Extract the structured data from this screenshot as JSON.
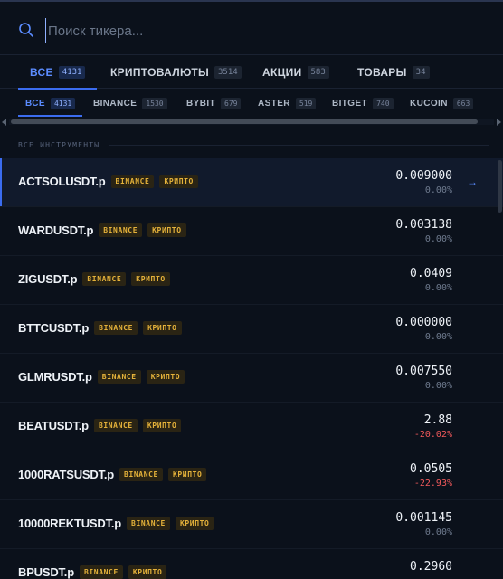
{
  "search": {
    "placeholder": "Поиск тикера..."
  },
  "tabs_primary": [
    {
      "label": "ВСЕ",
      "count": "4131",
      "active": true
    },
    {
      "label": "КРИПТОВАЛЮТЫ",
      "count": "3514"
    },
    {
      "label": "АКЦИИ",
      "count": "583"
    },
    {
      "label": "ТОВАРЫ",
      "count": "34"
    }
  ],
  "tabs_exchange": [
    {
      "label": "ВСЕ",
      "count": "4131",
      "active": true
    },
    {
      "label": "BINANCE",
      "count": "1530"
    },
    {
      "label": "BYBIT",
      "count": "679"
    },
    {
      "label": "ASTER",
      "count": "519"
    },
    {
      "label": "BITGET",
      "count": "740"
    },
    {
      "label": "KUCOIN",
      "count": "663"
    }
  ],
  "section_label": "ВСЕ ИНСТРУМЕНТЫ",
  "instruments": [
    {
      "symbol": "ACTSOLUSDT.p",
      "exchange": "BINANCE",
      "type": "КРИПТО",
      "price": "0.009000",
      "change": "0.00%",
      "direction": "flat",
      "selected": true
    },
    {
      "symbol": "WARDUSDT.p",
      "exchange": "BINANCE",
      "type": "КРИПТО",
      "price": "0.003138",
      "change": "0.00%",
      "direction": "flat"
    },
    {
      "symbol": "ZIGUSDT.p",
      "exchange": "BINANCE",
      "type": "КРИПТО",
      "price": "0.0409",
      "change": "0.00%",
      "direction": "flat"
    },
    {
      "symbol": "BTTCUSDT.p",
      "exchange": "BINANCE",
      "type": "КРИПТО",
      "price": "0.000000",
      "change": "0.00%",
      "direction": "flat"
    },
    {
      "symbol": "GLMRUSDT.p",
      "exchange": "BINANCE",
      "type": "КРИПТО",
      "price": "0.007550",
      "change": "0.00%",
      "direction": "flat"
    },
    {
      "symbol": "BEATUSDT.p",
      "exchange": "BINANCE",
      "type": "КРИПТО",
      "price": "2.88",
      "change": "-20.02%",
      "direction": "down"
    },
    {
      "symbol": "1000RATSUSDT.p",
      "exchange": "BINANCE",
      "type": "КРИПТО",
      "price": "0.0505",
      "change": "-22.93%",
      "direction": "down"
    },
    {
      "symbol": "10000REKTUSDT.p",
      "exchange": "BINANCE",
      "type": "КРИПТО",
      "price": "0.001145",
      "change": "0.00%",
      "direction": "flat"
    },
    {
      "symbol": "BPUSDT.p",
      "exchange": "BINANCE",
      "type": "КРИПТО",
      "price": "0.2960",
      "change": "",
      "direction": "flat"
    }
  ],
  "icons": {
    "search": "search-icon",
    "open": "arrow-right-icon"
  },
  "colors": {
    "accent": "#3b6cf0",
    "tag": "#e5b23a",
    "negative": "#f0595b",
    "background": "#0b111b"
  }
}
